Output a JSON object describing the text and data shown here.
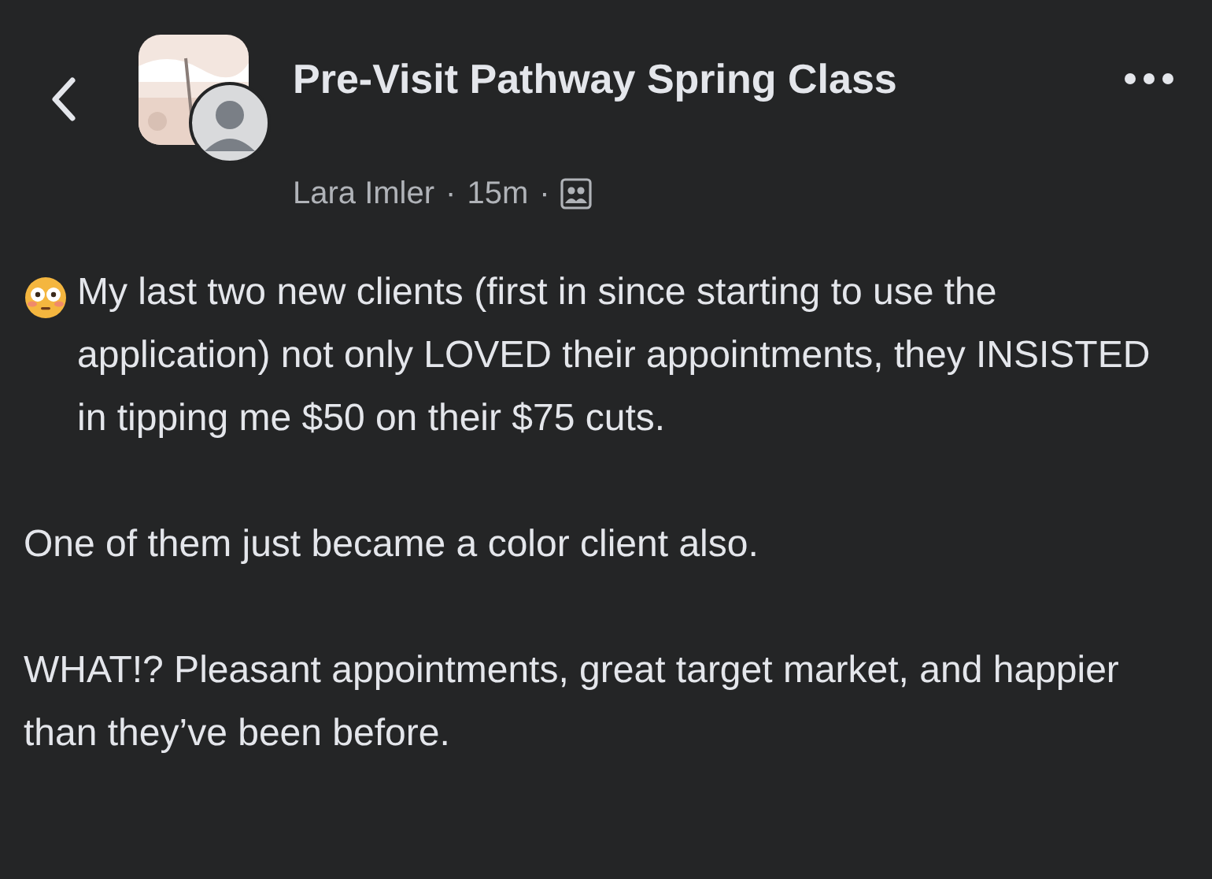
{
  "header": {
    "group_name": "Pre-Visit Pathway Spring Class",
    "author": "Lara Imler",
    "separator": "·",
    "time": "15m",
    "separator_2": "·"
  },
  "post": {
    "paragraphs": [
      {
        "kind": "emoji",
        "text": "My last two new clients (first in since starting to use the application) not only LOVED their appointments, they INSISTED in tipping me $50 on their $75 cuts."
      },
      {
        "kind": "plain",
        "text": "One of them just became a color client also."
      },
      {
        "kind": "plain",
        "text": "WHAT!? Pleasant appointments, great target market, and happier than they’ve been before."
      }
    ]
  }
}
